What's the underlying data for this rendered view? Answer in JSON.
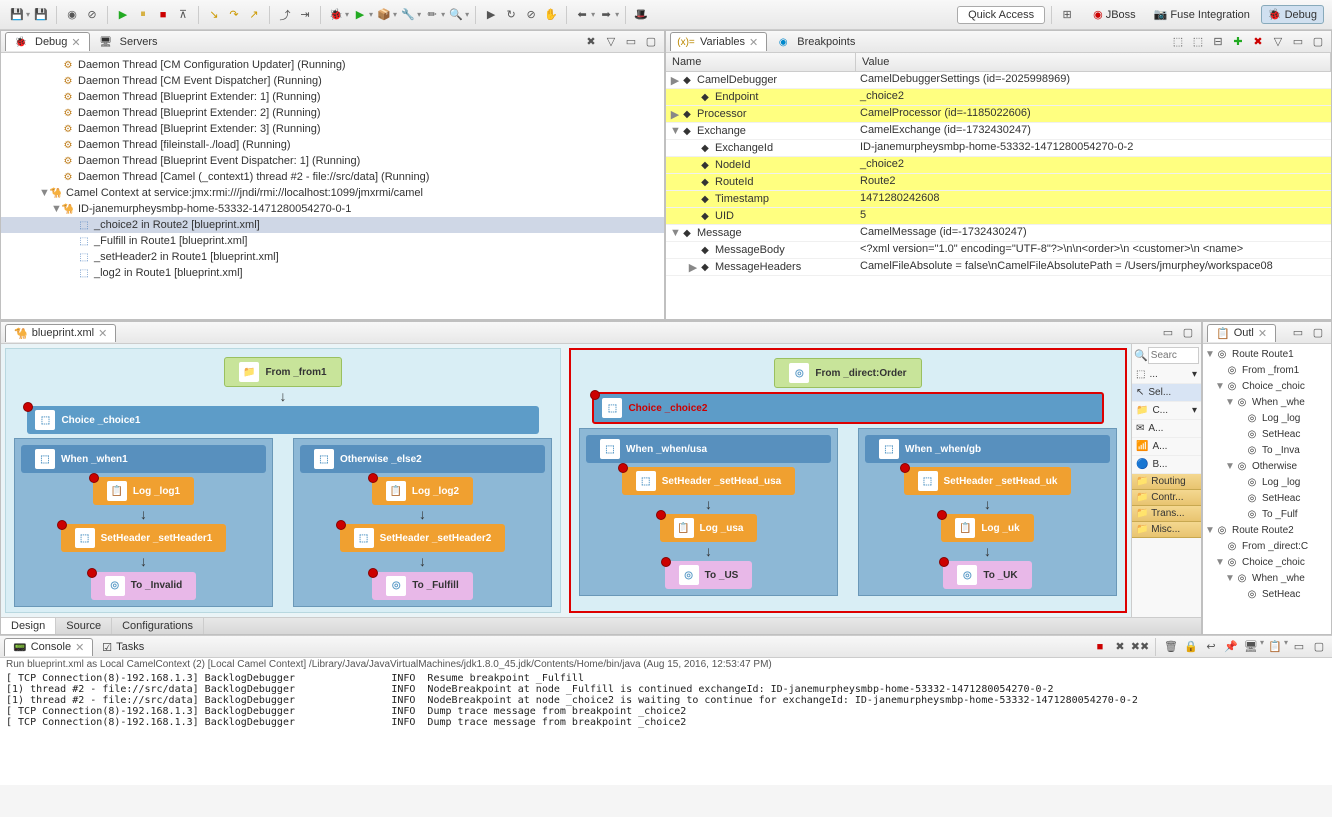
{
  "toolbar": {
    "quick_access": "Quick Access"
  },
  "perspectives": [
    {
      "label": "JBoss"
    },
    {
      "label": "Fuse Integration"
    },
    {
      "label": "Debug"
    }
  ],
  "debug_view": {
    "tabs": {
      "debug": "Debug",
      "servers": "Servers"
    },
    "threads": [
      "Daemon Thread [CM Configuration Updater] (Running)",
      "Daemon Thread [CM Event Dispatcher] (Running)",
      "Daemon Thread [Blueprint Extender: 1] (Running)",
      "Daemon Thread [Blueprint Extender: 2] (Running)",
      "Daemon Thread [Blueprint Extender: 3] (Running)",
      "Daemon Thread [fileinstall-./load] (Running)",
      "Daemon Thread [Blueprint Event Dispatcher: 1] (Running)",
      "Daemon Thread [Camel (_context1) thread #2 - file://src/data] (Running)"
    ],
    "camel_ctx": "Camel Context at service:jmx:rmi:///jndi/rmi://localhost:1099/jmxrmi/camel",
    "exchange": "ID-janemurpheysmbp-home-53332-1471280054270-0-1",
    "frames": [
      {
        "label": "_choice2 in Route2 [blueprint.xml]",
        "selected": true
      },
      {
        "label": "_Fulfill in Route1 [blueprint.xml]",
        "selected": false
      },
      {
        "label": "_setHeader2 in Route1 [blueprint.xml]",
        "selected": false
      },
      {
        "label": "_log2 in Route1 [blueprint.xml]",
        "selected": false
      }
    ]
  },
  "variables_view": {
    "tabs": {
      "variables": "Variables",
      "breakpoints": "Breakpoints"
    },
    "cols": {
      "name": "Name",
      "value": "Value"
    },
    "rows": [
      {
        "name": "CamelDebugger",
        "value": "CamelDebuggerSettings (id=-2025998969)",
        "indent": 0,
        "hl": false,
        "tw": "▶"
      },
      {
        "name": "Endpoint",
        "value": "_choice2",
        "indent": 1,
        "hl": true,
        "tw": ""
      },
      {
        "name": "Processor",
        "value": "CamelProcessor (id=-1185022606)",
        "indent": 0,
        "hl": true,
        "tw": "▶"
      },
      {
        "name": "Exchange",
        "value": "CamelExchange (id=-1732430247)",
        "indent": 0,
        "hl": false,
        "tw": "▼"
      },
      {
        "name": "ExchangeId",
        "value": "ID-janemurpheysmbp-home-53332-1471280054270-0-2",
        "indent": 1,
        "hl": false,
        "tw": ""
      },
      {
        "name": "NodeId",
        "value": "_choice2",
        "indent": 1,
        "hl": true,
        "tw": ""
      },
      {
        "name": "RouteId",
        "value": "Route2",
        "indent": 1,
        "hl": true,
        "tw": ""
      },
      {
        "name": "Timestamp",
        "value": "1471280242608",
        "indent": 1,
        "hl": true,
        "tw": ""
      },
      {
        "name": "UID",
        "value": "5",
        "indent": 1,
        "hl": true,
        "tw": ""
      },
      {
        "name": "Message",
        "value": "CamelMessage (id=-1732430247)",
        "indent": 0,
        "hl": false,
        "tw": "▼"
      },
      {
        "name": "MessageBody",
        "value": "<?xml version=\"1.0\" encoding=\"UTF-8\"?>\\n\\n<order>\\n   <customer>\\n     <name>",
        "indent": 1,
        "hl": false,
        "tw": ""
      },
      {
        "name": "MessageHeaders",
        "value": "CamelFileAbsolute = false\\nCamelFileAbsolutePath = /Users/jmurphey/workspace08",
        "indent": 1,
        "hl": false,
        "tw": "▶"
      }
    ]
  },
  "editor": {
    "file": "blueprint.xml",
    "route1": {
      "from": "From _from1",
      "choice": "Choice _choice1",
      "when": "When _when1",
      "else": "Otherwise _else2",
      "log1": "Log _log1",
      "log2": "Log _log2",
      "sh1": "SetHeader _setHeader1",
      "sh2": "SetHeader _setHeader2",
      "to1": "To _Invalid",
      "to2": "To _Fulfill"
    },
    "route2": {
      "from": "From _direct:Order",
      "choice": "Choice _choice2",
      "when_usa": "When _when/usa",
      "when_gb": "When _when/gb",
      "sh_usa": "SetHeader _setHead_usa",
      "sh_uk": "SetHeader _setHead_uk",
      "log_usa": "Log _usa",
      "log_uk": "Log _uk",
      "to_us": "To _US",
      "to_uk": "To _UK"
    },
    "palette": {
      "search_ph": "Searc",
      "items": [
        "...",
        "Sel...",
        "C...",
        "A...",
        "A...",
        "B..."
      ],
      "drawers": [
        "Routing",
        "Contr...",
        "Trans...",
        "Misc..."
      ]
    },
    "bottom_tabs": [
      "Design",
      "Source",
      "Configurations"
    ]
  },
  "outline": {
    "tab": "Outl",
    "rows": [
      {
        "t": "Route Route1",
        "i": 0,
        "tw": "▼"
      },
      {
        "t": "From _from1",
        "i": 1,
        "tw": ""
      },
      {
        "t": "Choice _choic",
        "i": 1,
        "tw": "▼"
      },
      {
        "t": "When _whe",
        "i": 2,
        "tw": "▼"
      },
      {
        "t": "Log _log",
        "i": 3,
        "tw": ""
      },
      {
        "t": "SetHeac",
        "i": 3,
        "tw": ""
      },
      {
        "t": "To _Inva",
        "i": 3,
        "tw": ""
      },
      {
        "t": "Otherwise",
        "i": 2,
        "tw": "▼"
      },
      {
        "t": "Log _log",
        "i": 3,
        "tw": ""
      },
      {
        "t": "SetHeac",
        "i": 3,
        "tw": ""
      },
      {
        "t": "To _Fulf",
        "i": 3,
        "tw": ""
      },
      {
        "t": "Route Route2",
        "i": 0,
        "tw": "▼"
      },
      {
        "t": "From _direct:C",
        "i": 1,
        "tw": ""
      },
      {
        "t": "Choice _choic",
        "i": 1,
        "tw": "▼"
      },
      {
        "t": "When _whe",
        "i": 2,
        "tw": "▼"
      },
      {
        "t": "SetHeac",
        "i": 3,
        "tw": ""
      }
    ]
  },
  "console": {
    "tabs": {
      "console": "Console",
      "tasks": "Tasks"
    },
    "title": "Run blueprint.xml as Local CamelContext (2) [Local Camel Context] /Library/Java/JavaVirtualMachines/jdk1.8.0_45.jdk/Contents/Home/bin/java (Aug 15, 2016, 12:53:47 PM)",
    "lines": [
      "[ TCP Connection(8)-192.168.1.3] BacklogDebugger                INFO  Resume breakpoint _Fulfill",
      "[1) thread #2 - file://src/data] BacklogDebugger                INFO  NodeBreakpoint at node _Fulfill is continued exchangeId: ID-janemurpheysmbp-home-53332-1471280054270-0-2",
      "[1) thread #2 - file://src/data] BacklogDebugger                INFO  NodeBreakpoint at node _choice2 is waiting to continue for exchangeId: ID-janemurpheysmbp-home-53332-1471280054270-0-2",
      "[ TCP Connection(8)-192.168.1.3] BacklogDebugger                INFO  Dump trace message from breakpoint _choice2",
      "[ TCP Connection(8)-192.168.1.3] BacklogDebugger                INFO  Dump trace message from breakpoint _choice2"
    ]
  }
}
